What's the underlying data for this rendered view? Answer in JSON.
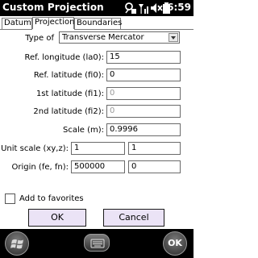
{
  "titlebar": {
    "title": "Custom Projection",
    "time": "6:59",
    "icons": [
      "connectivity-icon",
      "signal-icon",
      "volume-mute-icon",
      "battery-icon"
    ]
  },
  "tabs": [
    {
      "label": "Datum",
      "active": false
    },
    {
      "label": "Projection",
      "active": true
    },
    {
      "label": "Boundaries",
      "active": false
    }
  ],
  "form": {
    "type_label": "Type of",
    "type_value": "Transverse Mercator",
    "ref_longitude_label": "Ref. longitude (la0):",
    "ref_longitude_value": "15",
    "ref_latitude_label": "Ref. latitude (fi0):",
    "ref_latitude_value": "0",
    "first_latitude_label": "1st latitude (fi1):",
    "first_latitude_value": "0",
    "second_latitude_label": "2nd latitude (fi2):",
    "second_latitude_value": "0",
    "scale_label": "Scale (m):",
    "scale_value": "0.9996",
    "unit_scale_label": "Unit scale (xy,z):",
    "unit_scale_xy": "1",
    "unit_scale_z": "1",
    "origin_label": "Origin (fe, fn):",
    "origin_fe": "500000",
    "origin_fn": "0"
  },
  "favorites": {
    "label": "Add to favorites",
    "checked": false
  },
  "buttons": {
    "ok": "OK",
    "cancel": "Cancel"
  },
  "bottombar": {
    "right_label": "OK"
  },
  "colors": {
    "button_bg": "#ebe3f6",
    "bar_bg": "#000000"
  }
}
